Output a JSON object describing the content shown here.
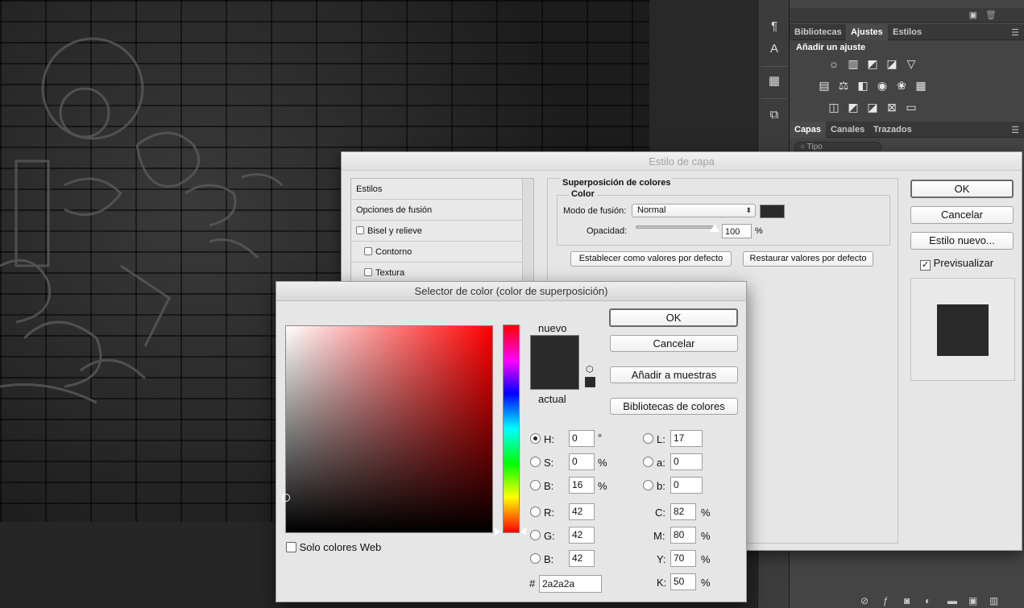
{
  "panels": {
    "tabs_top": [
      "Bibliotecas",
      "Ajustes",
      "Estilos"
    ],
    "active_top": "Ajustes",
    "adjust_title": "Añadir un ajuste",
    "tabs_layers": [
      "Capas",
      "Canales",
      "Trazados"
    ],
    "layer_search": "Tipo"
  },
  "layer_style": {
    "title": "Estilo de capa",
    "list": [
      {
        "label": "Estilos",
        "checkbox": false,
        "indent": false
      },
      {
        "label": "Opciones de fusión",
        "checkbox": false,
        "indent": false
      },
      {
        "label": "Bisel y relieve",
        "checkbox": true,
        "indent": false
      },
      {
        "label": "Contorno",
        "checkbox": true,
        "indent": true
      },
      {
        "label": "Textura",
        "checkbox": true,
        "indent": true
      }
    ],
    "section_title": "Superposición de colores",
    "subsection_title": "Color",
    "blend_label": "Modo de fusión:",
    "blend_value": "Normal",
    "opacity_label": "Opacidad:",
    "opacity_value": "100",
    "opacity_unit": "%",
    "opacity_fraction": 1.0,
    "set_default": "Establecer como valores por defecto",
    "reset_default": "Restaurar valores por defecto",
    "ok": "OK",
    "cancel": "Cancelar",
    "new_style": "Estilo nuevo...",
    "preview": "Previsualizar",
    "preview_checked": true,
    "overlay_color": "#2a2a2a"
  },
  "color_picker": {
    "title": "Selector de color (color de superposición)",
    "new_label": "nuevo",
    "current_label": "actual",
    "ok": "OK",
    "cancel": "Cancelar",
    "add_swatches": "Añadir a muestras",
    "libraries": "Bibliotecas de colores",
    "web_only": "Solo colores Web",
    "fields": {
      "H": {
        "label": "H:",
        "value": "0",
        "unit": "°",
        "selected": true
      },
      "S": {
        "label": "S:",
        "value": "0",
        "unit": "%"
      },
      "Bv": {
        "label": "B:",
        "value": "16",
        "unit": "%"
      },
      "R": {
        "label": "R:",
        "value": "42"
      },
      "G": {
        "label": "G:",
        "value": "42"
      },
      "Bc": {
        "label": "B:",
        "value": "42"
      },
      "L": {
        "label": "L:",
        "value": "17"
      },
      "a": {
        "label": "a:",
        "value": "0"
      },
      "b": {
        "label": "b:",
        "value": "0"
      },
      "C": {
        "label": "C:",
        "value": "82",
        "unit": "%"
      },
      "M": {
        "label": "M:",
        "value": "80",
        "unit": "%"
      },
      "Y": {
        "label": "Y:",
        "value": "70",
        "unit": "%"
      },
      "K": {
        "label": "K:",
        "value": "50",
        "unit": "%"
      }
    },
    "hash": "#",
    "hex": "2a2a2a",
    "current_color": "#2a2a2a"
  }
}
